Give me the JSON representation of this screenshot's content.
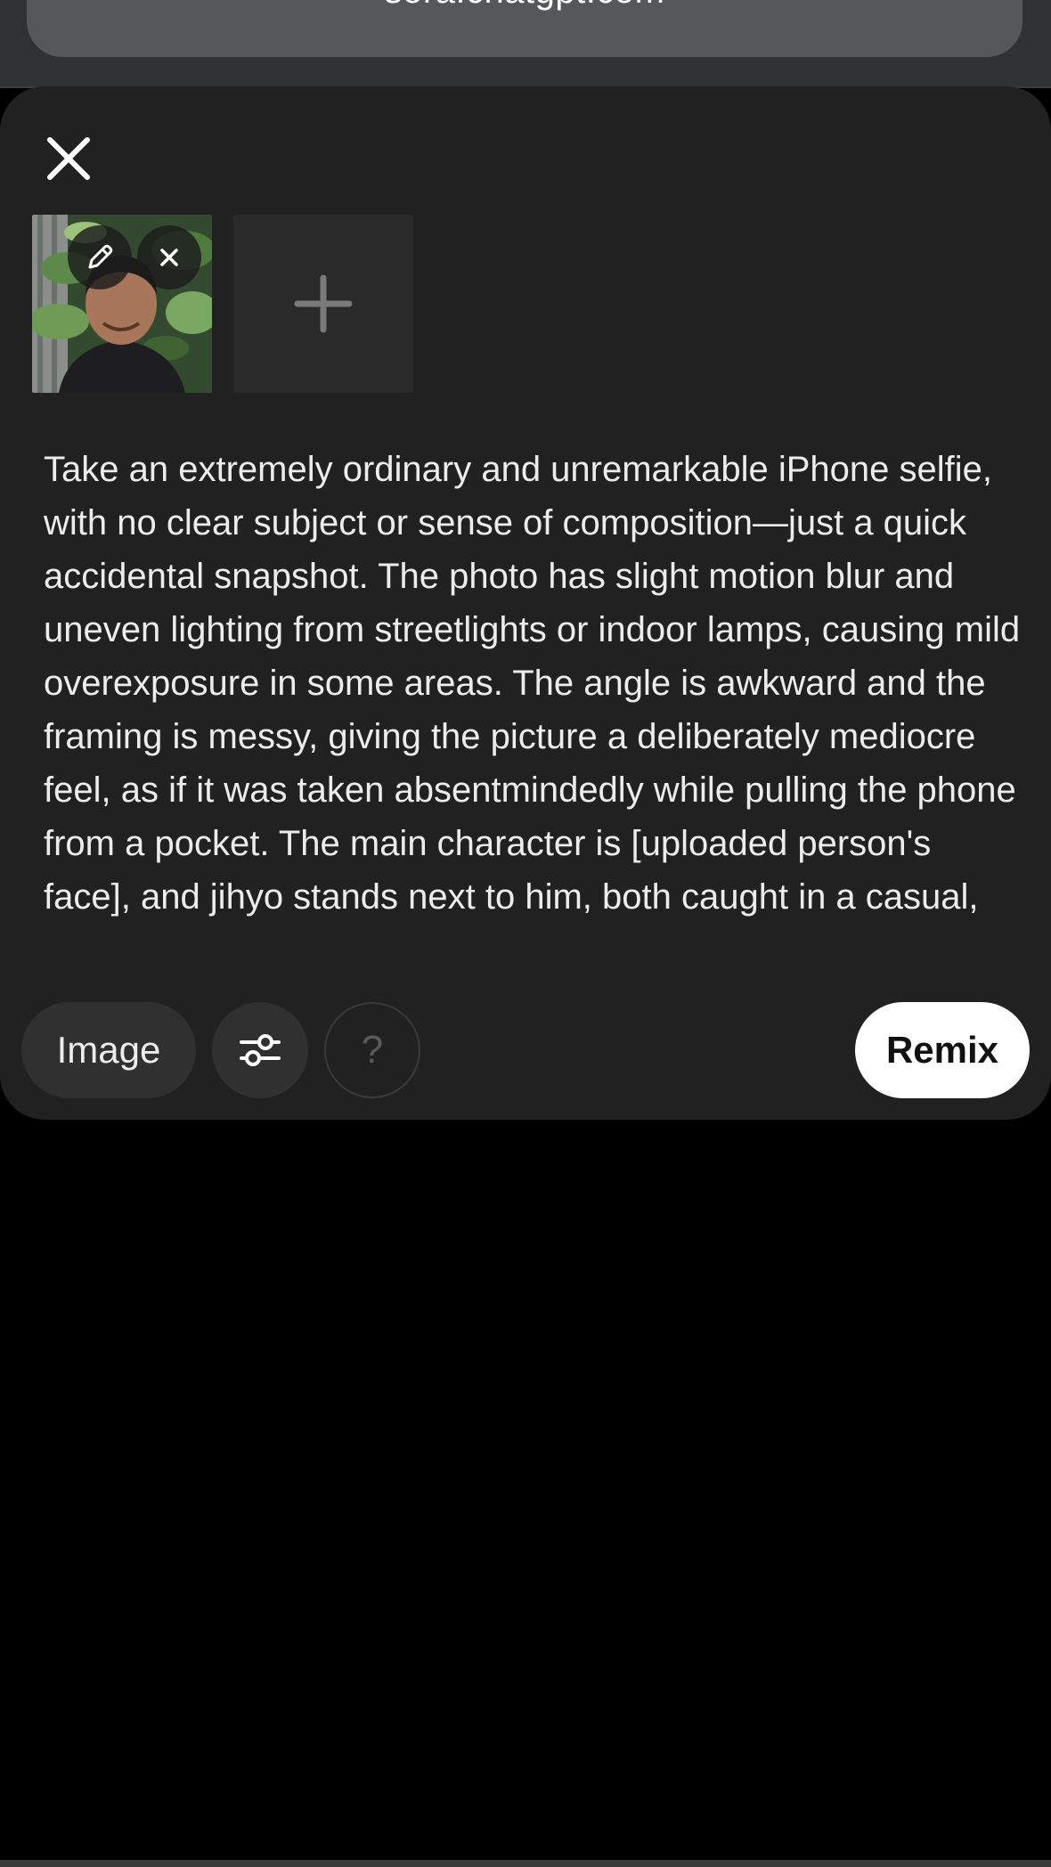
{
  "browser": {
    "url": "sora.chatgpt.com",
    "icons": [
      "lens-icon",
      "share-icon"
    ]
  },
  "sheet": {
    "close_icon": "close-icon",
    "attachments": [
      {
        "kind": "photo-thumbnail",
        "actions": [
          "edit-pencil-icon",
          "remove-x-icon"
        ]
      }
    ],
    "add_icon": "plus-icon",
    "prompt": "Take an extremely ordinary and unremarkable iPhone selfie, with no clear subject or sense of composition—just a quick accidental snapshot. The photo has slight motion blur and uneven lighting from streetlights or indoor lamps, causing mild overexposure in some areas. The angle is awkward and the framing is messy, giving the picture a deliberately mediocre feel, as if it was taken absentmindedly while pulling the phone from a pocket. The main character is [uploaded person's face], and jihyo stands next to him, both caught in a casual,",
    "toolbar": {
      "image_label": "Image",
      "settings_icon": "sliders-icon",
      "help_label": "?",
      "remix_label": "Remix"
    }
  },
  "colors": {
    "page_bg": "#000000",
    "sheet_bg": "#212121",
    "pill_bg": "#303030",
    "remix_bg": "#ffffff",
    "url_pill": "#55585b"
  }
}
